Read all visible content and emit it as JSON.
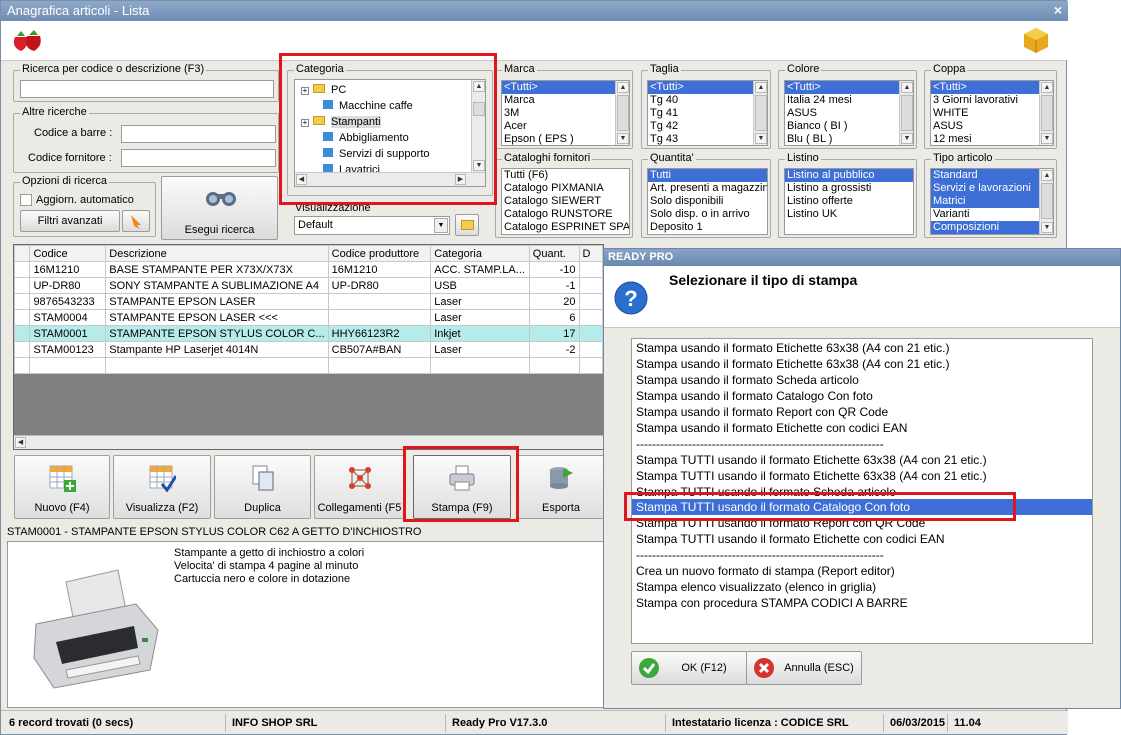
{
  "window": {
    "title": "Anagrafica articoli  - Lista",
    "close": "×"
  },
  "header": {
    "title": "Anagrafica articoli  - Lista"
  },
  "search": {
    "group_label": "Ricerca per codice o descrizione (F3)",
    "other_label": "Altre ricerche",
    "barcode_label": "Codice a barre :",
    "supplier_code_label": "Codice fornitore :",
    "options_label": "Opzioni di ricerca",
    "auto_update_label": "Aggiorn. automatico",
    "advanced_filters": "Filtri avanzati",
    "run_search": "Esegui ricerca"
  },
  "categoria": {
    "label": "Categoria",
    "items": [
      "PC",
      "Macchine caffe",
      "Stampanti",
      "Abbigliamento",
      "Servizi di supporto",
      "Lavatrici"
    ]
  },
  "visualizzazione": {
    "label": "Visualizzazione",
    "value": "Default"
  },
  "marca": {
    "label": "Marca",
    "items": [
      "<Tutti>",
      "Marca",
      "3M",
      "Acer",
      "Epson ( EPS )"
    ]
  },
  "taglia": {
    "label": "Taglia",
    "items": [
      "<Tutti>",
      "Tg 40",
      "Tg 41",
      "Tg 42",
      "Tg 43"
    ]
  },
  "colore": {
    "label": "Colore",
    "items": [
      "<Tutti>",
      "Italia 24 mesi",
      "ASUS",
      "Bianco ( BI )",
      "Blu ( BL )"
    ]
  },
  "coppa": {
    "label": "Coppa",
    "items": [
      "<Tutti>",
      "3 Giorni lavorativi",
      "WHITE",
      "ASUS",
      "12 mesi"
    ]
  },
  "cataloghi": {
    "label": "Cataloghi fornitori",
    "items": [
      "Tutti (F6)",
      "Catalogo PIXMANIA",
      "Catalogo SIEWERT",
      "Catalogo RUNSTORE",
      "Catalogo ESPRINET SPA"
    ]
  },
  "quantita": {
    "label": "Quantita'",
    "items": [
      "Tutti",
      "Art. presenti a magazzino",
      "Solo disponibili",
      "Solo disp. o in arrivo",
      "Deposito 1"
    ]
  },
  "listino": {
    "label": "Listino",
    "items": [
      "Listino al pubblico",
      "Listino a grossisti",
      "Listino offerte",
      "Listino UK"
    ]
  },
  "tipo_articolo": {
    "label": "Tipo articolo",
    "items": [
      "Standard",
      "Servizi e lavorazioni",
      "Matrici",
      "Varianti",
      "Composizioni"
    ]
  },
  "grid": {
    "columns": [
      "Codice",
      "Descrizione",
      "Codice produttore",
      "Categoria",
      "Quant.",
      "D"
    ],
    "rows": [
      [
        "16M1210",
        "BASE STAMPANTE PER X73X/X73X",
        "16M1210",
        "ACC. STAMP.LA...",
        "-10"
      ],
      [
        "UP-DR80",
        "SONY STAMPANTE A SUBLIMAZIONE A4",
        "UP-DR80",
        "USB",
        "-1"
      ],
      [
        "9876543233",
        "STAMPANTE EPSON LASER",
        "",
        "Laser",
        "20"
      ],
      [
        "STAM0004",
        "STAMPANTE EPSON LASER <<<",
        "",
        "Laser",
        "6"
      ],
      [
        "STAM0001",
        "STAMPANTE EPSON STYLUS COLOR C...",
        "HHY66123R2",
        "Inkjet",
        "17"
      ],
      [
        "STAM00123",
        "Stampante HP Laserjet 4014N",
        "CB507A#BAN",
        "Laser",
        "-2"
      ]
    ]
  },
  "toolbar": {
    "nuovo": "Nuovo (F4)",
    "visualizza": "Visualizza (F2)",
    "duplica": "Duplica",
    "collegamenti": "Collegamenti (F5",
    "stampa": "Stampa (F9)",
    "esporta": "Esporta"
  },
  "detail": {
    "title": "STAM0001 - STAMPANTE EPSON STYLUS COLOR C62 A GETTO D'INCHIOSTRO",
    "lines": [
      "Stampante a getto di inchiostro a colori",
      "Velocita' di stampa 4 pagine al minuto",
      "Cartuccia nero e colore in dotazione"
    ]
  },
  "status": {
    "records": "6 record trovati (0 secs)",
    "company": "INFO SHOP SRL",
    "version": "Ready Pro V17.3.0",
    "license": "Intestatario licenza : CODICE SRL",
    "date": "06/03/2015",
    "time": "11.04"
  },
  "dialog": {
    "title": "READY PRO",
    "question": "Selezionare il tipo di stampa",
    "options": [
      "Stampa usando il formato Etichette 63x38 (A4 con 21 etic.)",
      "Stampa usando il formato Etichette 63x38 (A4 con 21 etic.)",
      "Stampa usando il formato Scheda articolo",
      "Stampa usando il formato Catalogo Con foto",
      "Stampa usando il formato Report con QR Code",
      "Stampa usando il formato Etichette con codici EAN",
      "--------------------------------------------------------------",
      "Stampa TUTTI usando il formato Etichette 63x38 (A4 con 21 etic.)",
      "Stampa TUTTI usando il formato Etichette 63x38 (A4 con 21 etic.)",
      "Stampa TUTTI usando il formato Scheda articolo",
      "Stampa TUTTI usando il formato Catalogo Con foto",
      "Stampa TUTTI usando il formato Report con QR Code",
      "Stampa TUTTI usando il formato Etichette con codici EAN",
      "--------------------------------------------------------------",
      "Crea un nuovo formato di stampa (Report editor)",
      "Stampa elenco visualizzato (elenco in griglia)",
      "Stampa con procedura STAMPA CODICI A BARRE"
    ],
    "selected_index": 10,
    "ok": "OK (F12)",
    "cancel": "Annulla (ESC)"
  },
  "colors": {
    "highlight": "#b6ebec",
    "selection": "#3d6fd6",
    "annotation": "#e0151d"
  }
}
